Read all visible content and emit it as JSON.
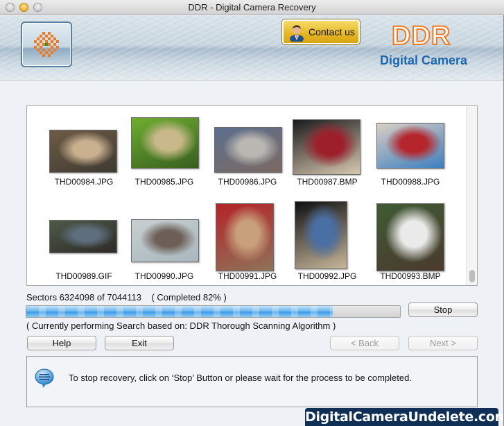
{
  "window": {
    "title": "DDR - Digital Camera Recovery"
  },
  "header": {
    "contact_label": "Contact us",
    "brand_name": "DDR",
    "brand_subtitle": "Digital Camera",
    "logo_icon": "scan-grid-icon",
    "contact_icon": "user-support-icon"
  },
  "thumbnails": [
    {
      "name": "THD00984.JPG",
      "colors": [
        "#6d5b46",
        "#c9b08f",
        "#3f3a31"
      ]
    },
    {
      "name": "THD00985.JPG",
      "colors": [
        "#6fae2f",
        "#c9b98a",
        "#375f20"
      ]
    },
    {
      "name": "THD00986.JPG",
      "colors": [
        "#5c6f8f",
        "#b9b7b2",
        "#7b6a63"
      ]
    },
    {
      "name": "THD00987.BMP",
      "colors": [
        "#1b1b1d",
        "#9d1f2b",
        "#d8c8b0"
      ]
    },
    {
      "name": "THD00988.JPG",
      "colors": [
        "#d9cfc4",
        "#b4262c",
        "#3e7fbf"
      ]
    },
    {
      "name": "THD00989.GIF",
      "colors": [
        "#4d5a47",
        "#5f6e7d",
        "#2e2a28"
      ]
    },
    {
      "name": "THD00990.JPG",
      "colors": [
        "#c8cfd0",
        "#6d5f58",
        "#a9b8bf"
      ]
    },
    {
      "name": "THD00991.JPG",
      "colors": [
        "#b52328",
        "#c8a07c",
        "#8e7359"
      ]
    },
    {
      "name": "THD00992.JPG",
      "colors": [
        "#0f0f12",
        "#4a6fa4",
        "#c7b79a"
      ]
    },
    {
      "name": "THD00993.BMP",
      "colors": [
        "#3f5a34",
        "#eaeaea",
        "#4b3a2e"
      ]
    }
  ],
  "progress": {
    "sectors_text": "Sectors 6324098 of 7044113    ( Completed 82% )",
    "sectors_done": 6324098,
    "sectors_total": 7044113,
    "percent_complete": 82,
    "status_text": "( Currently performing Search based on: DDR Thorough Scanning Algorithm )"
  },
  "buttons": {
    "stop": "Stop",
    "help": "Help",
    "exit": "Exit",
    "back": "< Back",
    "next": "Next >"
  },
  "info": {
    "icon": "speech-bubble-icon",
    "message": "To stop recovery, click on ‘Stop’ Button or please wait for the process to be completed."
  },
  "watermark": "DigitalCameraUndelete.com",
  "colors": {
    "brand_orange": "#f07a22",
    "brand_blue": "#1b68b0",
    "progress_blue": "#3d9ae6",
    "watermark_bg": "#0f2f54"
  }
}
